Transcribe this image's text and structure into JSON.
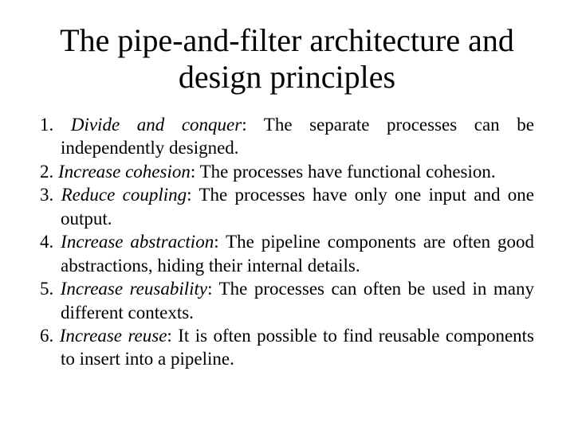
{
  "title": "The pipe-and-filter architecture and design principles",
  "items": [
    {
      "num": "1.",
      "name": "Divide and conquer",
      "desc": ": The separate processes can be independently designed."
    },
    {
      "num": "2.",
      "name": "Increase cohesion",
      "desc": ": The processes have functional cohesion."
    },
    {
      "num": "3.",
      "name": "Reduce coupling",
      "desc": ": The processes have only one input and one output."
    },
    {
      "num": "4.",
      "name": "Increase abstraction",
      "desc": ": The pipeline components are often good abstractions, hiding their internal details."
    },
    {
      "num": "5.",
      "name": "Increase reusability",
      "desc": ": The processes can often be used in many different contexts."
    },
    {
      "num": "6.",
      "name": "Increase reuse",
      "desc": ": It is often possible to find reusable components to insert into a pipeline."
    }
  ]
}
